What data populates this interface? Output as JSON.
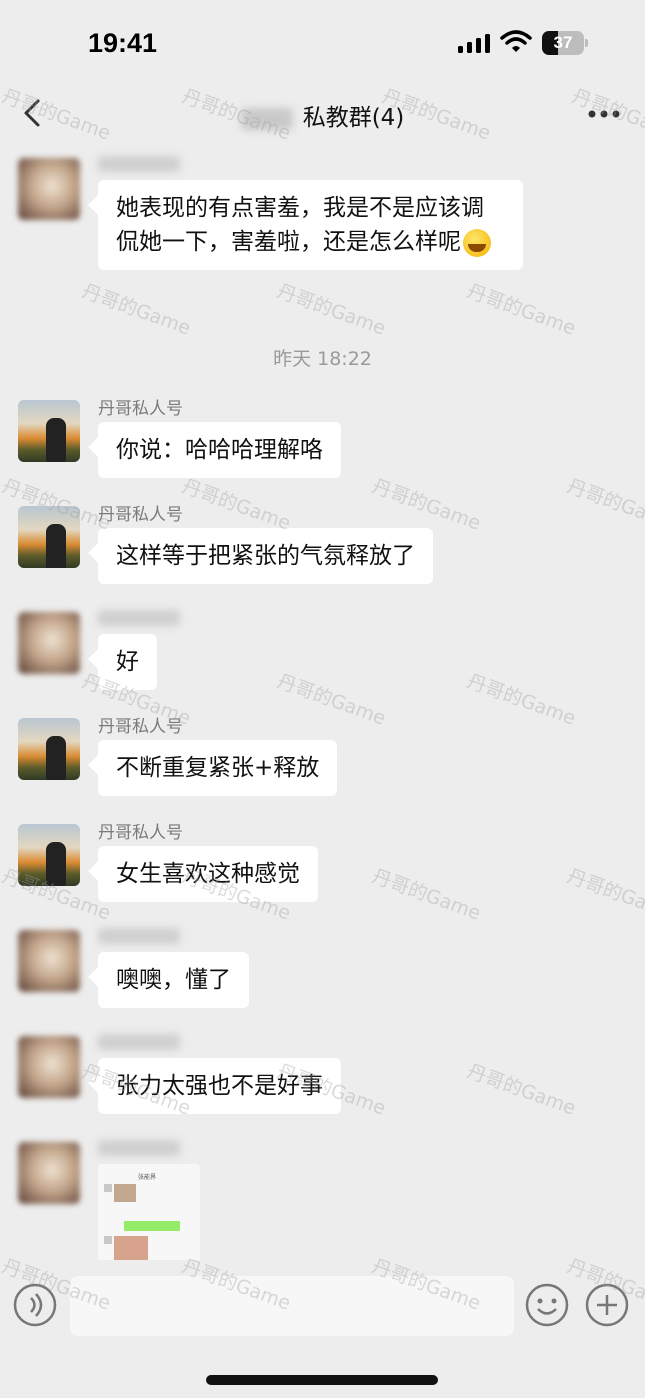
{
  "status_bar": {
    "time": "19:41",
    "battery_level": "37",
    "battery_fraction": 0.37
  },
  "nav": {
    "title": "私教群(4)"
  },
  "messages": [
    {
      "sender": "",
      "text": "她表现的有点害羞，我是不是应该调侃她一下，害羞啦，还是怎么样呢",
      "emoji": "face-with-tears-of-joy"
    },
    {
      "sender": "丹哥私人号",
      "text": "你说：哈哈哈理解咯"
    },
    {
      "sender": "丹哥私人号",
      "text": "这样等于把紧张的气氛释放了"
    },
    {
      "sender": "",
      "text": "好"
    },
    {
      "sender": "丹哥私人号",
      "text": "不断重复紧张+释放"
    },
    {
      "sender": "丹哥私人号",
      "text": "女生喜欢这种感觉"
    },
    {
      "sender": "",
      "text": "噢噢，懂了"
    },
    {
      "sender": "",
      "text": "张力太强也不是好事"
    }
  ],
  "timestamp": "昨天 18:22",
  "image_message": {
    "thumb_title": "张能界"
  },
  "watermark": "丹哥的Game",
  "icons": {
    "signal": "signal-icon",
    "wifi": "wifi-icon",
    "back": "back-icon",
    "more": "more-icon",
    "voice": "voice-icon",
    "emoji": "emoji-icon",
    "plus": "plus-icon"
  },
  "colors": {
    "background": "#ededed",
    "bubble": "#ffffff",
    "meta_text": "#7a7a7a"
  }
}
